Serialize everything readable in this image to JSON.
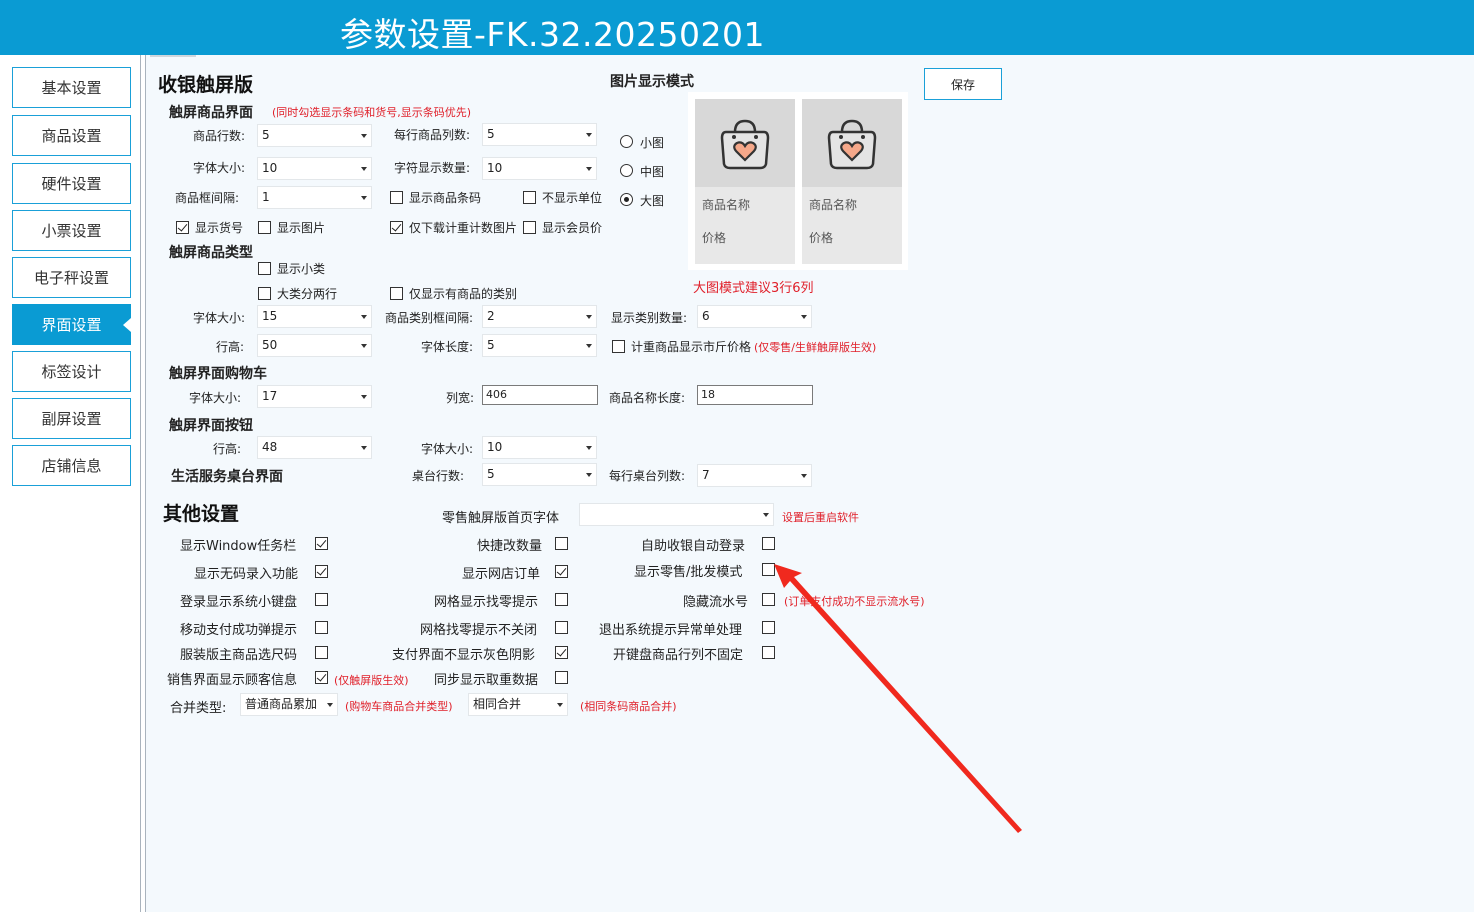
{
  "title": "参数设置-FK.32.20250201",
  "nav": [
    {
      "label": "基本设置",
      "active": false
    },
    {
      "label": "商品设置",
      "active": false
    },
    {
      "label": "硬件设置",
      "active": false
    },
    {
      "label": "小票设置",
      "active": false
    },
    {
      "label": "电子秤设置",
      "active": false
    },
    {
      "label": "界面设置",
      "active": true
    },
    {
      "label": "标签设计",
      "active": false
    },
    {
      "label": "副屏设置",
      "active": false
    },
    {
      "label": "店铺信息",
      "active": false
    }
  ],
  "save_label": "保存",
  "touch": {
    "title": "收银触屏版",
    "goods_ui": {
      "title": "触屏商品界面",
      "note": "(同时勾选显示条码和货号,显示条码优先)",
      "rows_label": "商品行数:",
      "rows_value": "5",
      "cols_label": "每行商品列数:",
      "cols_value": "5",
      "font_label": "字体大小:",
      "font_value": "10",
      "chars_label": "字符显示数量:",
      "chars_value": "10",
      "gap_label": "商品框间隔:",
      "gap_value": "1",
      "show_barcode": "显示商品条码",
      "hide_unit": "不显示单位",
      "show_itemno": "显示货号",
      "show_image": "显示图片",
      "download_weigh_img": "仅下载计重计数图片",
      "show_member_price": "显示会员价"
    },
    "image_mode": {
      "title": "图片显示模式",
      "small": "小图",
      "medium": "中图",
      "large": "大图",
      "selected": "大图",
      "card_name": "商品名称",
      "card_price": "价格",
      "tip": "大图模式建议3行6列"
    },
    "category": {
      "title": "触屏商品类型",
      "show_sub": "显示小类",
      "two_rows": "大类分两行",
      "only_with_goods": "仅显示有商品的类别",
      "font_label": "字体大小:",
      "font_value": "15",
      "gap_label": "商品类别框间隔:",
      "gap_value": "2",
      "count_label": "显示类别数量:",
      "count_value": "6",
      "height_label": "行高:",
      "height_value": "50",
      "len_label": "字体长度:",
      "len_value": "5",
      "jin_price": "计重商品显示市斤价格",
      "jin_note": "(仅零售/生鲜触屏版生效)"
    },
    "cart": {
      "title": "触屏界面购物车",
      "font_label": "字体大小:",
      "font_value": "17",
      "width_label": "列宽:",
      "width_value": "406",
      "namelen_label": "商品名称长度:",
      "namelen_value": "18"
    },
    "buttons": {
      "title": "触屏界面按钮",
      "height_label": "行高:",
      "height_value": "48",
      "font_label": "字体大小:",
      "font_value": "10"
    },
    "life": {
      "title": "生活服务桌台界面",
      "rows_label": "桌台行数:",
      "rows_value": "5",
      "cols_label": "每行桌台列数:",
      "cols_value": "7"
    }
  },
  "other": {
    "title": "其他设置",
    "home_font_label": "零售触屏版首页字体",
    "home_font_value": "",
    "restart_note": "设置后重启软件",
    "items": [
      {
        "label": "显示Window任务栏",
        "checked": true
      },
      {
        "label": "快捷改数量",
        "checked": false
      },
      {
        "label": "自助收银自动登录",
        "checked": false
      },
      {
        "label": "显示无码录入功能",
        "checked": true
      },
      {
        "label": "显示网店订单",
        "checked": true
      },
      {
        "label": "显示零售/批发模式",
        "checked": false
      },
      {
        "label": "登录显示系统小键盘",
        "checked": false
      },
      {
        "label": "网格显示找零提示",
        "checked": false
      },
      {
        "label": "隐藏流水号",
        "checked": false
      },
      {
        "label": "移动支付成功弹提示",
        "checked": false
      },
      {
        "label": "网格找零提示不关闭",
        "checked": false
      },
      {
        "label": "退出系统提示异常单处理",
        "checked": false
      },
      {
        "label": "服装版主商品选尺码",
        "checked": false
      },
      {
        "label": "支付界面不显示灰色阴影",
        "checked": true
      },
      {
        "label": "开键盘商品行列不固定",
        "checked": false
      },
      {
        "label": "销售界面显示顾客信息",
        "checked": true
      },
      {
        "label": "同步显示取重数据",
        "checked": false
      }
    ],
    "serial_note": "(订单支付成功不显示流水号)",
    "customer_note": "(仅触屏版生效)",
    "merge_label": "合并类型:",
    "merge_value": "普通商品累加",
    "merge_note": "(购物车商品合并类型)",
    "merge2_value": "相同合并",
    "merge2_note": "(相同条码商品合并)"
  },
  "colors": {
    "accent": "#0a9bd3",
    "warning": "#e0202a",
    "annotation_arrow": "#f0291e"
  }
}
